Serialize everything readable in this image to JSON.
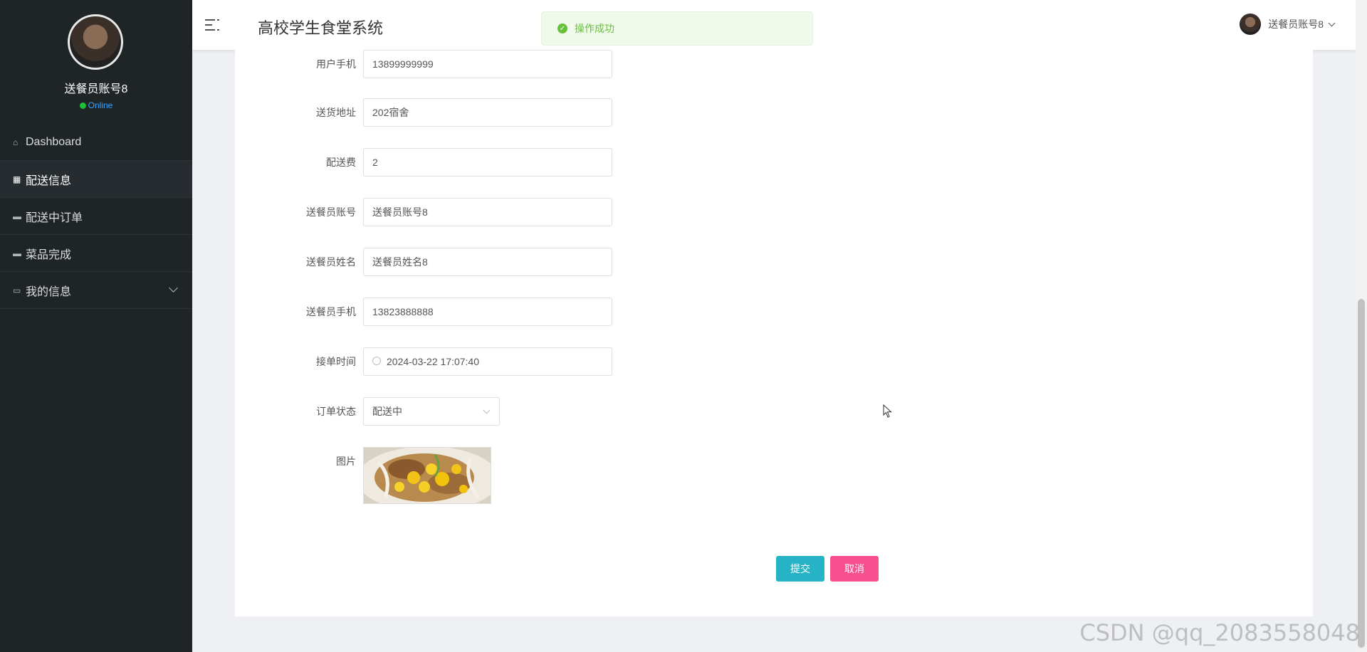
{
  "sidebar": {
    "user_name": "送餐员账号8",
    "status": "Online",
    "items": [
      {
        "label": "Dashboard",
        "icon": "home-icon"
      },
      {
        "label": "配送信息",
        "icon": "grid-icon"
      },
      {
        "label": "配送中订单",
        "icon": "monitor-icon"
      },
      {
        "label": "菜品完成",
        "icon": "monitor-icon"
      },
      {
        "label": "我的信息",
        "icon": "card-icon"
      }
    ]
  },
  "header": {
    "title": "高校学生食堂系统",
    "user": "送餐员账号8"
  },
  "toast": {
    "message": "操作成功"
  },
  "form": {
    "phone": {
      "label": "用户手机",
      "value": "13899999999"
    },
    "address": {
      "label": "送货地址",
      "value": "202宿舍"
    },
    "fee": {
      "label": "配送费",
      "value": "2"
    },
    "courier_account": {
      "label": "送餐员账号",
      "value": "送餐员账号8"
    },
    "courier_name": {
      "label": "送餐员姓名",
      "value": "送餐员姓名8"
    },
    "courier_phone": {
      "label": "送餐员手机",
      "value": "13823888888"
    },
    "order_time": {
      "label": "接单时间",
      "value": "2024-03-22 17:07:40"
    },
    "order_status": {
      "label": "订单状态",
      "value": "配送中"
    },
    "image": {
      "label": "图片"
    }
  },
  "buttons": {
    "submit": "提交",
    "cancel": "取消"
  },
  "watermark": "CSDN @qq_2083558048",
  "colors": {
    "sidebar_bg": "#1f2427",
    "submit": "#26b3c5",
    "cancel": "#f6508f",
    "success": "#67c23a"
  }
}
